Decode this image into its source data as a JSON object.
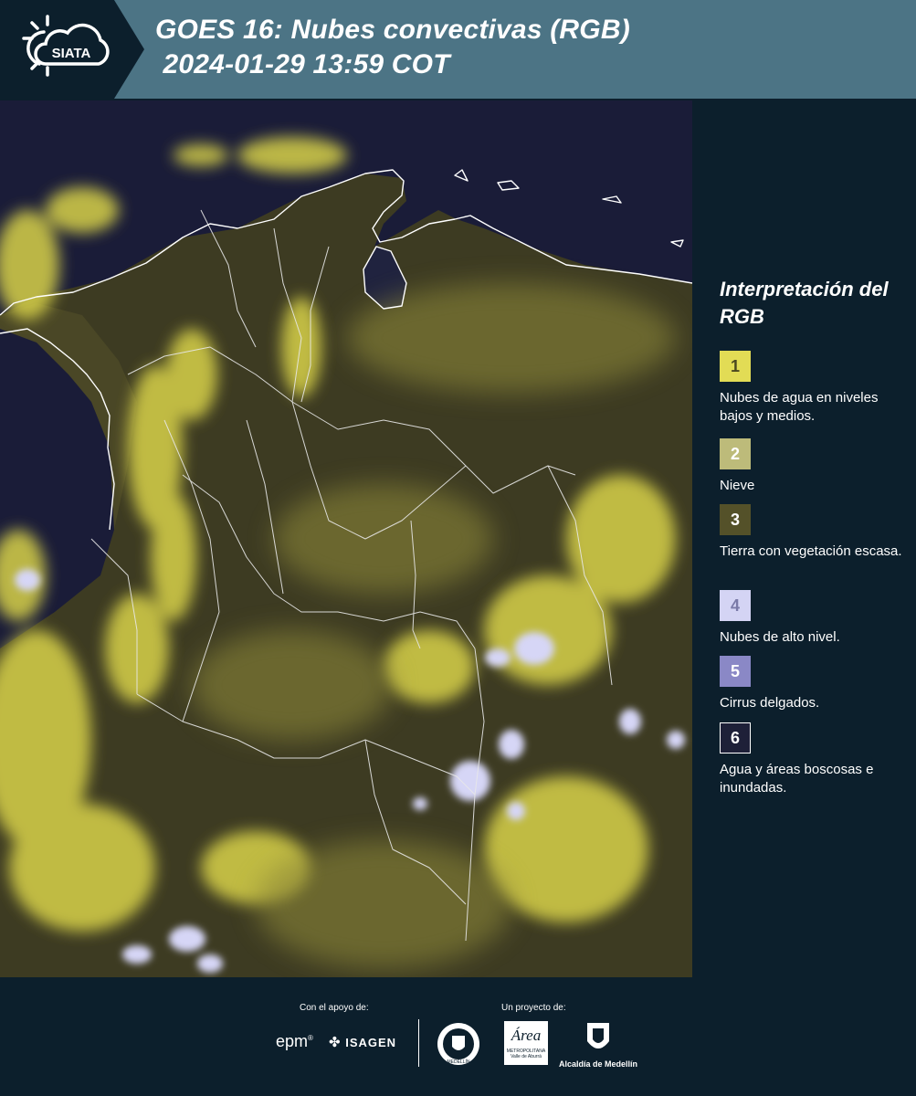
{
  "header": {
    "logo_text": "SIATA",
    "title": "GOES 16: Nubes convectivas (RGB)\n 2024-01-29 13:59 COT"
  },
  "legend": {
    "title": "Interpretación del RGB",
    "items": [
      {
        "number": "1",
        "label": "Nubes de agua en niveles bajos y medios.",
        "color": "#e2dc55",
        "text_color": "#4a4720"
      },
      {
        "number": "2",
        "label": "Nieve",
        "color": "#bdbb7a",
        "text_color": "#ffffff"
      },
      {
        "number": "3",
        "label": "Tierra con vegetación escasa.",
        "color": "#545129",
        "text_color": "#ffffff"
      },
      {
        "number": "4",
        "label": "Nubes de alto nivel.",
        "color": "#d4d4f4",
        "text_color": "#7a7aa8"
      },
      {
        "number": "5",
        "label": "Cirrus delgados.",
        "color": "#8a88c6",
        "text_color": "#ffffff"
      },
      {
        "number": "6",
        "label": "Agua y áreas boscosas e inundadas.",
        "color": "#1e2038",
        "text_color": "#ffffff"
      }
    ]
  },
  "footer": {
    "support_label": "Con el apoyo de:",
    "project_label": "Un proyecto de:",
    "epm_text": "epm",
    "isagen_text": "ISAGEN",
    "area_text": "Área",
    "area_sub": "METROPOLITANA",
    "area_sub2": "Valle de Aburrá",
    "alcaldia_text": "Alcaldía de Medellín",
    "seal_text": "MEDELLÍN"
  },
  "colors": {
    "header_bg": "#4c7485",
    "body_bg": "#0c1f2c",
    "map_water": "#1a1c38",
    "cloud_low": "#e2dc55",
    "land_sparse": "#545129",
    "cloud_high": "#d4d4f4"
  }
}
